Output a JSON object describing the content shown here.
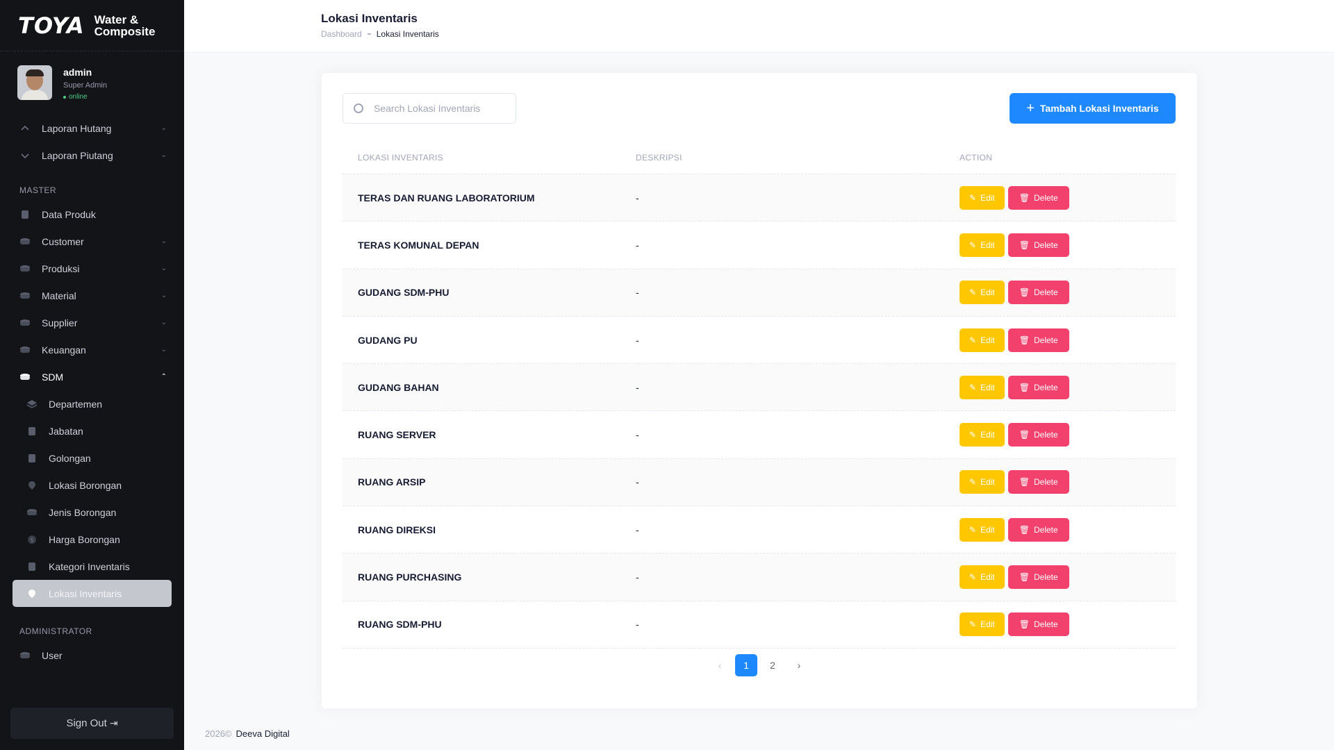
{
  "brand": {
    "logo": "TOYA",
    "subtitle_line1": "Water &",
    "subtitle_line2": "Composite"
  },
  "user": {
    "name": "admin",
    "role": "Super Admin",
    "status": "online"
  },
  "sidebar": {
    "top_items": [
      {
        "label": "Laporan Hutang",
        "icon": "chart-up-icon"
      },
      {
        "label": "Laporan Piutang",
        "icon": "chart-down-icon"
      }
    ],
    "master_title": "MASTER",
    "master_items": [
      {
        "label": "Data Produk"
      },
      {
        "label": "Customer"
      },
      {
        "label": "Produksi"
      },
      {
        "label": "Material"
      },
      {
        "label": "Supplier"
      },
      {
        "label": "Keuangan"
      },
      {
        "label": "SDM"
      }
    ],
    "sdm_items": [
      {
        "label": "Departemen"
      },
      {
        "label": "Jabatan"
      },
      {
        "label": "Golongan"
      },
      {
        "label": "Lokasi Borongan"
      },
      {
        "label": "Jenis Borongan"
      },
      {
        "label": "Harga Borongan"
      },
      {
        "label": "Kategori Inventaris"
      },
      {
        "label": "Lokasi Inventaris"
      }
    ],
    "admin_title": "ADMINISTRATOR",
    "admin_items": [
      {
        "label": "User"
      }
    ],
    "signout_label": "Sign Out"
  },
  "header": {
    "title": "Lokasi Inventaris",
    "breadcrumb_home": "Dashboard",
    "breadcrumb_current": "Lokasi Inventaris"
  },
  "toolbar": {
    "search_placeholder": "Search Lokasi Inventaris",
    "search_value": "",
    "add_label": "Tambah Lokasi Inventaris"
  },
  "table": {
    "headers": [
      "LOKASI INVENTARIS",
      "DESKRIPSI",
      "ACTION"
    ],
    "edit_label": "Edit",
    "delete_label": "Delete",
    "rows": [
      {
        "lokasi": "TERAS DAN RUANG LABORATORIUM",
        "deskripsi": "-"
      },
      {
        "lokasi": "TERAS KOMUNAL DEPAN",
        "deskripsi": "-"
      },
      {
        "lokasi": "GUDANG SDM-PHU",
        "deskripsi": "-"
      },
      {
        "lokasi": "GUDANG PU",
        "deskripsi": "-"
      },
      {
        "lokasi": "GUDANG BAHAN",
        "deskripsi": "-"
      },
      {
        "lokasi": "RUANG SERVER",
        "deskripsi": "-"
      },
      {
        "lokasi": "RUANG ARSIP",
        "deskripsi": "-"
      },
      {
        "lokasi": "RUANG DIREKSI",
        "deskripsi": "-"
      },
      {
        "lokasi": "RUANG PURCHASING",
        "deskripsi": "-"
      },
      {
        "lokasi": "RUANG SDM-PHU",
        "deskripsi": "-"
      }
    ]
  },
  "pagination": {
    "prev": "‹",
    "pages": [
      "1",
      "2"
    ],
    "current": "1",
    "next": "›"
  },
  "footer": {
    "year": "2026©",
    "brand": "Deeva Digital"
  },
  "colors": {
    "primary": "#1e88ff",
    "warning": "#ffc700",
    "danger": "#f1416c",
    "sidebar": "#131418"
  }
}
